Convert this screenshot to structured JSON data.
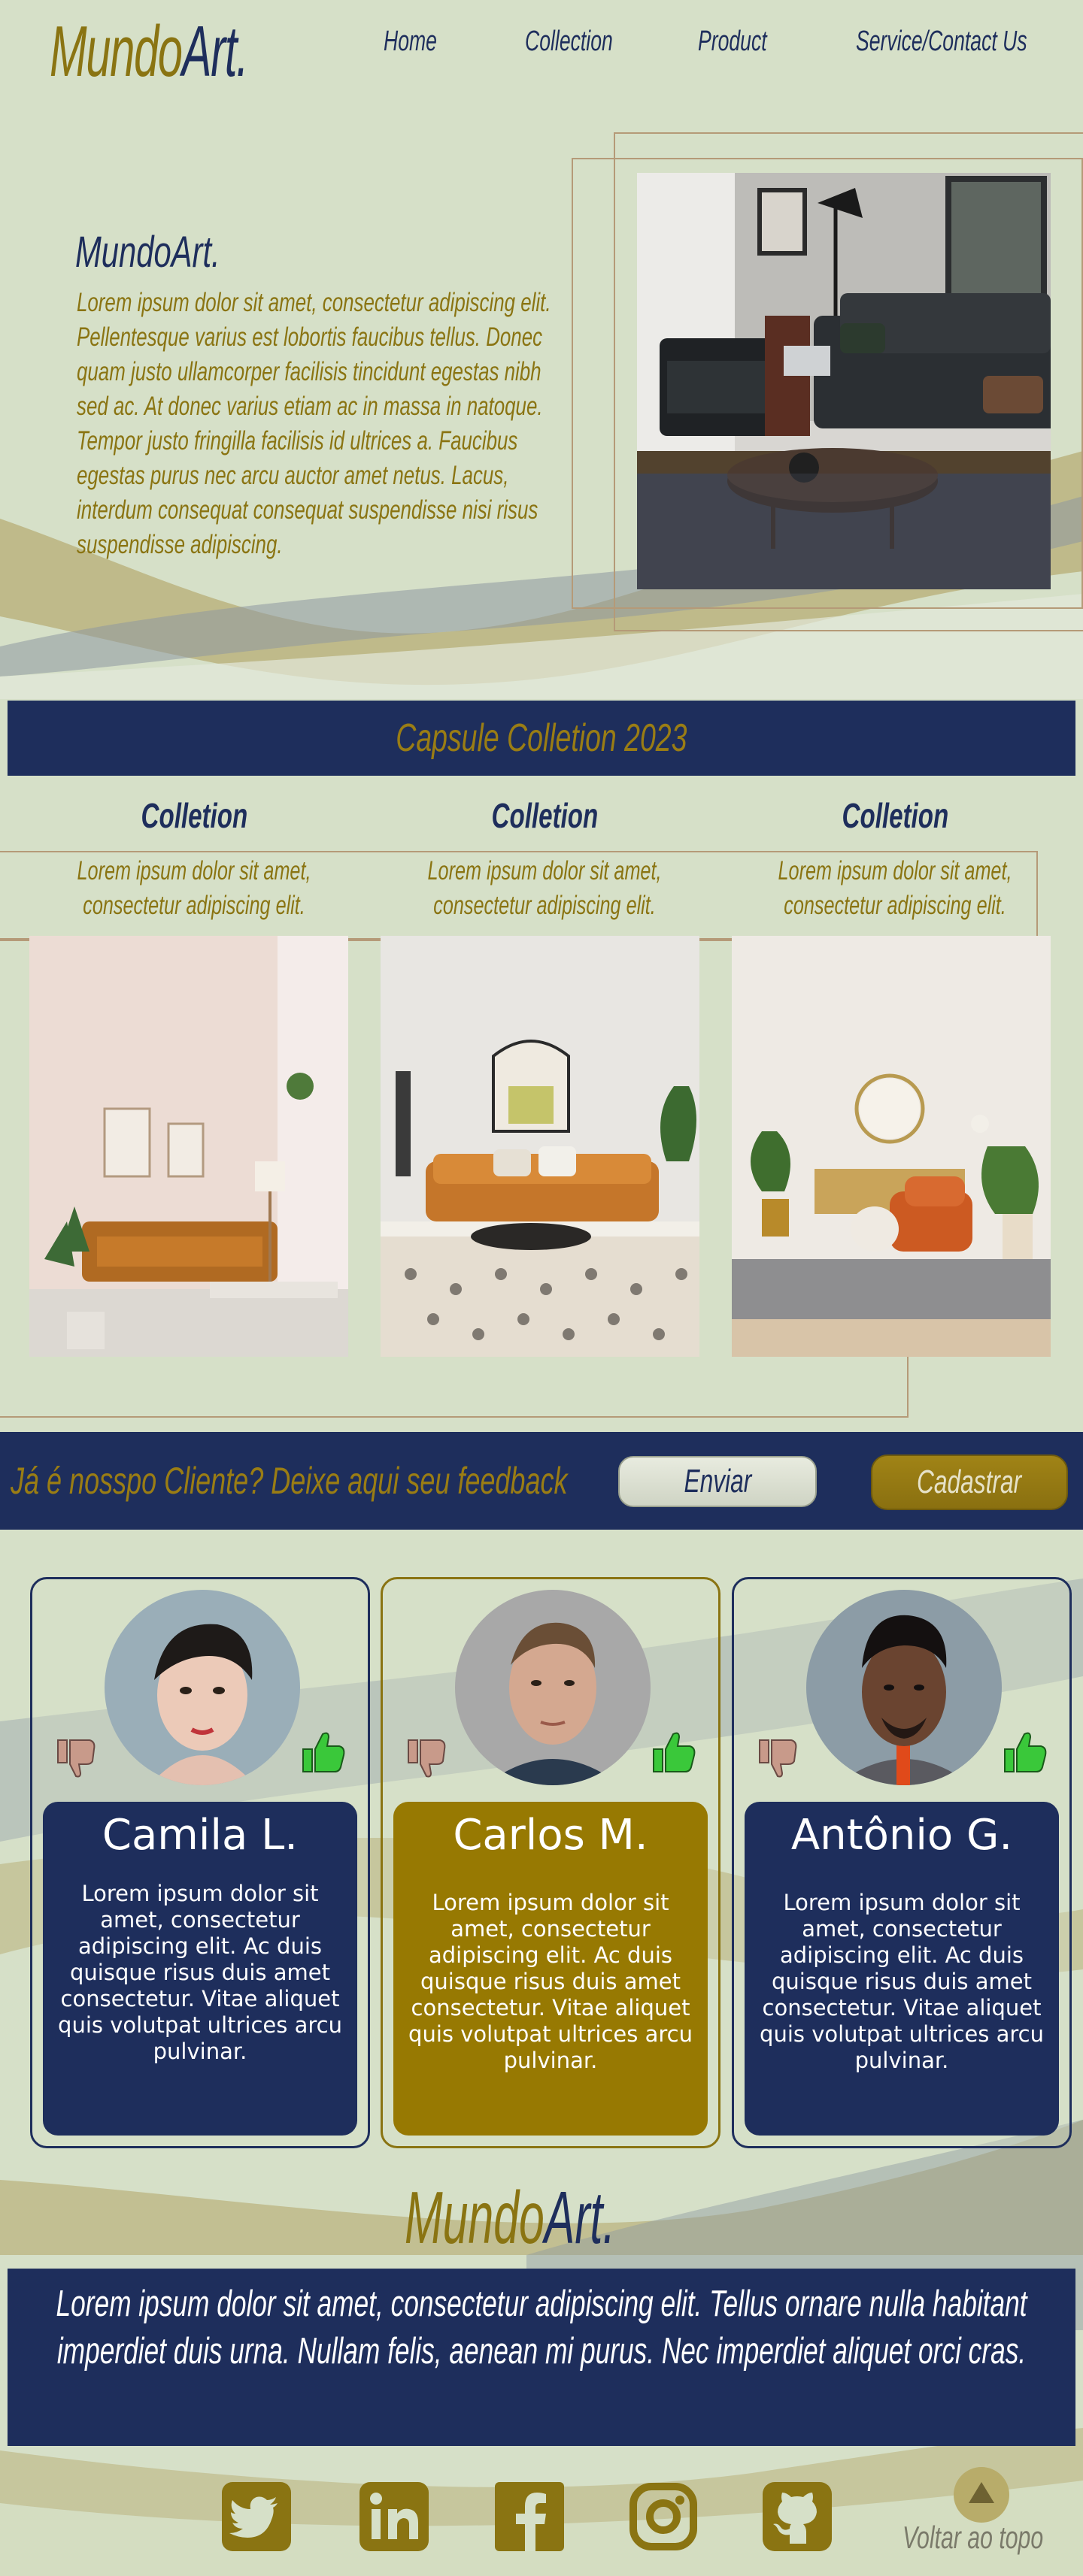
{
  "brand": {
    "logo_part1": "Mundo",
    "logo_part2": "Art."
  },
  "nav": {
    "items": [
      "Home",
      "Collection",
      "Product",
      "Service/Contact Us"
    ]
  },
  "hero": {
    "title": "MundoArt.",
    "text": "Lorem ipsum dolor sit amet, consectetur adipiscing elit. Pellentesque varius est lobortis faucibus tellus. Donec quam justo ullamcorper facilisis tincidunt egestas nibh sed ac. At donec varius etiam ac in massa in natoque. Tempor justo fringilla facilisis id ultrices a. Faucibus egestas purus nec arcu auctor amet netus. Lacus, interdum consequat consequat suspendisse nisi risus suspendisse adipiscing."
  },
  "capsule": {
    "title": "Capsule Colletion 2023",
    "collections": [
      {
        "title": "Colletion",
        "desc": "Lorem ipsum dolor sit amet, consectetur adipiscing elit."
      },
      {
        "title": "Colletion",
        "desc": "Lorem ipsum dolor sit amet, consectetur adipiscing elit."
      },
      {
        "title": "Colletion",
        "desc": "Lorem ipsum dolor sit amet, consectetur adipiscing elit."
      }
    ]
  },
  "feedback": {
    "prompt": "Já é nosspo Cliente? Deixe aqui seu feedback",
    "send_label": "Enviar",
    "register_label": "Cadastrar"
  },
  "testimonials": [
    {
      "name": "Camila L.",
      "text": "Lorem ipsum dolor sit amet, consectetur adipiscing elit. Ac duis quisque risus duis amet consectetur. Vitae aliquet quis volutpat ultrices arcu pulvinar."
    },
    {
      "name": "Carlos M.",
      "text": "Lorem ipsum dolor sit amet, consectetur adipiscing elit. Ac duis quisque risus duis amet consectetur. Vitae aliquet quis volutpat ultrices arcu pulvinar."
    },
    {
      "name": "Antônio G.",
      "text": "Lorem ipsum dolor sit amet, consectetur adipiscing elit. Ac duis quisque risus duis amet consectetur. Vitae aliquet quis volutpat ultrices arcu pulvinar."
    }
  ],
  "footer": {
    "logo_part1": "Mundo",
    "logo_part2": "Art.",
    "text": "Lorem ipsum dolor sit amet, consectetur adipiscing elit. Tellus ornare nulla habitant imperdiet duis urna. Nullam felis, aenean mi purus. Nec imperdiet aliquet orci cras.",
    "social_icons": [
      "twitter-icon",
      "linkedin-icon",
      "facebook-icon",
      "instagram-icon",
      "github-icon"
    ],
    "back_to_top": "Voltar ao topo"
  },
  "colors": {
    "navy": "#1e2e5c",
    "gold": "#8a7412",
    "background": "#d6e0c8",
    "like_green": "#3ac83a",
    "dislike_pink": "#c89a8a"
  }
}
